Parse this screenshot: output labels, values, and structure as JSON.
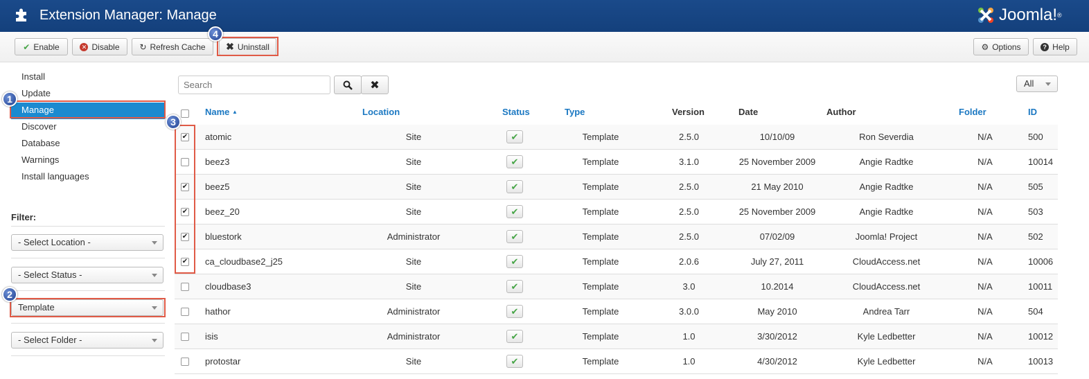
{
  "header": {
    "title": "Extension Manager: Manage",
    "logo_text": "Joomla!",
    "logo_mark": "®",
    "icon": "puzzle-icon"
  },
  "toolbar": {
    "enable": "Enable",
    "disable": "Disable",
    "refresh": "Refresh Cache",
    "uninstall": "Uninstall",
    "options": "Options",
    "help": "Help"
  },
  "badges": [
    "1",
    "2",
    "3",
    "4"
  ],
  "sidebar": {
    "items": [
      "Install",
      "Update",
      "Manage",
      "Discover",
      "Database",
      "Warnings",
      "Install languages"
    ],
    "active": 2,
    "filter_label": "Filter:",
    "filters": [
      "- Select Location -",
      "- Select Status -",
      "Template",
      "- Select Folder -"
    ]
  },
  "search": {
    "placeholder": "Search"
  },
  "limit": {
    "value": "All"
  },
  "table": {
    "columns": {
      "name": "Name",
      "sort_arrow": "▲",
      "location": "Location",
      "status": "Status",
      "type": "Type",
      "version": "Version",
      "date": "Date",
      "author": "Author",
      "folder": "Folder",
      "id": "ID"
    },
    "rows": [
      {
        "checked": true,
        "name": "atomic",
        "location": "Site",
        "type": "Template",
        "version": "2.5.0",
        "date": "10/10/09",
        "author": "Ron Severdia",
        "folder": "N/A",
        "id": "500"
      },
      {
        "checked": false,
        "name": "beez3",
        "location": "Site",
        "type": "Template",
        "version": "3.1.0",
        "date": "25 November 2009",
        "author": "Angie Radtke",
        "folder": "N/A",
        "id": "10014"
      },
      {
        "checked": true,
        "name": "beez5",
        "location": "Site",
        "type": "Template",
        "version": "2.5.0",
        "date": "21 May 2010",
        "author": "Angie Radtke",
        "folder": "N/A",
        "id": "505"
      },
      {
        "checked": true,
        "name": "beez_20",
        "location": "Site",
        "type": "Template",
        "version": "2.5.0",
        "date": "25 November 2009",
        "author": "Angie Radtke",
        "folder": "N/A",
        "id": "503"
      },
      {
        "checked": true,
        "name": "bluestork",
        "location": "Administrator",
        "type": "Template",
        "version": "2.5.0",
        "date": "07/02/09",
        "author": "Joomla! Project",
        "folder": "N/A",
        "id": "502"
      },
      {
        "checked": true,
        "name": "ca_cloudbase2_j25",
        "location": "Site",
        "type": "Template",
        "version": "2.0.6",
        "date": "July 27, 2011",
        "author": "CloudAccess.net",
        "folder": "N/A",
        "id": "10006"
      },
      {
        "checked": false,
        "name": "cloudbase3",
        "location": "Site",
        "type": "Template",
        "version": "3.0",
        "date": "10.2014",
        "author": "CloudAccess.net",
        "folder": "N/A",
        "id": "10011"
      },
      {
        "checked": false,
        "name": "hathor",
        "location": "Administrator",
        "type": "Template",
        "version": "3.0.0",
        "date": "May 2010",
        "author": "Andrea Tarr",
        "folder": "N/A",
        "id": "504"
      },
      {
        "checked": false,
        "name": "isis",
        "location": "Administrator",
        "type": "Template",
        "version": "1.0",
        "date": "3/30/2012",
        "author": "Kyle Ledbetter",
        "folder": "N/A",
        "id": "10012"
      },
      {
        "checked": false,
        "name": "protostar",
        "location": "Site",
        "type": "Template",
        "version": "1.0",
        "date": "4/30/2012",
        "author": "Kyle Ledbetter",
        "folder": "N/A",
        "id": "10013"
      }
    ]
  }
}
